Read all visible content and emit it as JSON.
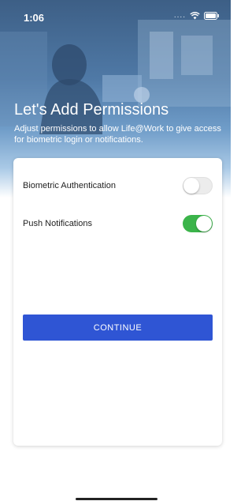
{
  "status_bar": {
    "time": "1:06",
    "signal": "....",
    "wifi_icon": "wifi-icon",
    "battery_icon": "battery-icon"
  },
  "header": {
    "title": "Let's Add Permissions",
    "subtitle": "Adjust permissions to allow Life@Work to give access for biometric login or notifications."
  },
  "permissions": [
    {
      "label": "Biometric Authentication",
      "enabled": false
    },
    {
      "label": "Push Notifications",
      "enabled": true
    }
  ],
  "continue_label": "CONTINUE",
  "colors": {
    "accent": "#2f55d4",
    "toggle_on": "#3bb44a",
    "toggle_off": "#ececec"
  }
}
